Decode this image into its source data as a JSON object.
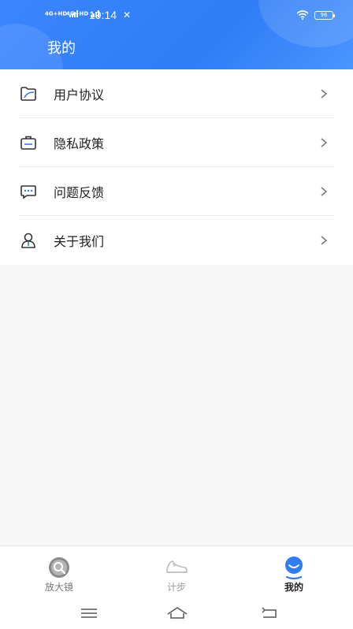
{
  "status_bar": {
    "signal1": "4G+HD",
    "signal2": "4G+HD",
    "time": "19:14",
    "battery": "96"
  },
  "header": {
    "title": "我的"
  },
  "menu": {
    "items": [
      {
        "label": "用户协议",
        "icon": "folder-icon"
      },
      {
        "label": "隐私政策",
        "icon": "briefcase-icon"
      },
      {
        "label": "问题反馈",
        "icon": "chat-bubble-icon"
      },
      {
        "label": "关于我们",
        "icon": "user-icon"
      }
    ]
  },
  "bottom_nav": {
    "items": [
      {
        "label": "放大镜",
        "icon": "magnifier-icon"
      },
      {
        "label": "计步",
        "icon": "sneaker-icon"
      },
      {
        "label": "我的",
        "icon": "profile-icon",
        "active": true
      }
    ]
  },
  "colors": {
    "accent": "#2f7cf6",
    "active_nav_icon": "#2f7cf6",
    "text_primary": "#222222",
    "text_muted": "#999999"
  }
}
